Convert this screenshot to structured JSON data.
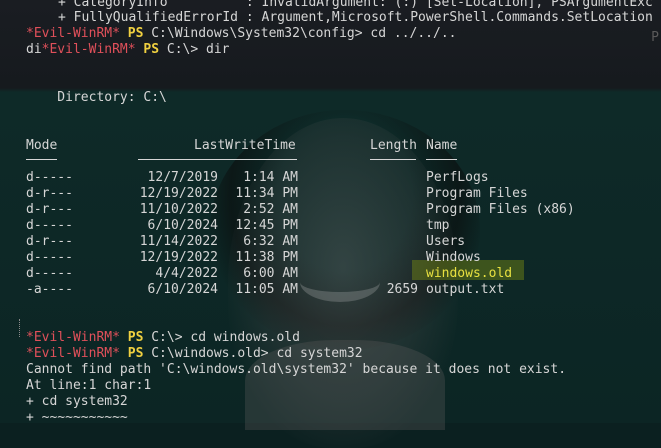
{
  "top_error": {
    "category_line": "+ CategoryInfo          : InvalidArgument: (:) [Set-Location], PSArgumentExc",
    "fqid_line": "+ FullyQualifiedErrorId : Argument,Microsoft.PowerShell.Commands.SetLocation"
  },
  "prompt1": {
    "star": "*Evil-WinRM*",
    "ps": "PS",
    "path_cmd": "C:\\Windows\\System32\\config> cd ../../.."
  },
  "prompt2": {
    "prefix": "di",
    "star": "*Evil-WinRM*",
    "ps": "PS",
    "path_cmd": "C:\\> dir"
  },
  "directory_line": "    Directory: C:\\",
  "headers": {
    "mode": "Mode",
    "lastwrite": "LastWriteTime",
    "length": "Length",
    "name": "Name"
  },
  "rows": [
    {
      "mode": "d-----",
      "date": "12/7/2019",
      "time": "1:14 AM",
      "length": "",
      "name": "PerfLogs"
    },
    {
      "mode": "d-r---",
      "date": "12/19/2022",
      "time": "11:34 PM",
      "length": "",
      "name": "Program Files"
    },
    {
      "mode": "d-r---",
      "date": "11/10/2022",
      "time": "2:52 AM",
      "length": "",
      "name": "Program Files (x86)"
    },
    {
      "mode": "d-----",
      "date": "6/10/2024",
      "time": "12:45 PM",
      "length": "",
      "name": "tmp"
    },
    {
      "mode": "d-r---",
      "date": "11/14/2022",
      "time": "6:32 AM",
      "length": "",
      "name": "Users"
    },
    {
      "mode": "d-----",
      "date": "12/19/2022",
      "time": "11:38 PM",
      "length": "",
      "name": "Windows"
    },
    {
      "mode": "d-----",
      "date": "4/4/2022",
      "time": "6:00 AM",
      "length": "",
      "name": "windows.old"
    },
    {
      "mode": "-a----",
      "date": "6/10/2024",
      "time": "11:05 AM",
      "length": "2659",
      "name": "output.txt"
    }
  ],
  "prompt3": {
    "star": "*Evil-WinRM*",
    "ps": "PS",
    "path_cmd": "C:\\> cd windows.old"
  },
  "prompt4": {
    "star": "*Evil-WinRM*",
    "ps": "PS",
    "path_cmd": "C:\\windows.old> cd system32"
  },
  "error_lines": [
    "Cannot find path 'C:\\windows.old\\system32' because it does not exist.",
    "At line:1 char:1",
    "+ cd system32",
    "+ ~~~~~~~~~~~"
  ],
  "edge_ghost": "P",
  "colors": {
    "prompt_red": "#e0505a",
    "ps_yellow": "#f0d040",
    "highlight": "#3a4a10",
    "text": "#d6d6d6"
  }
}
